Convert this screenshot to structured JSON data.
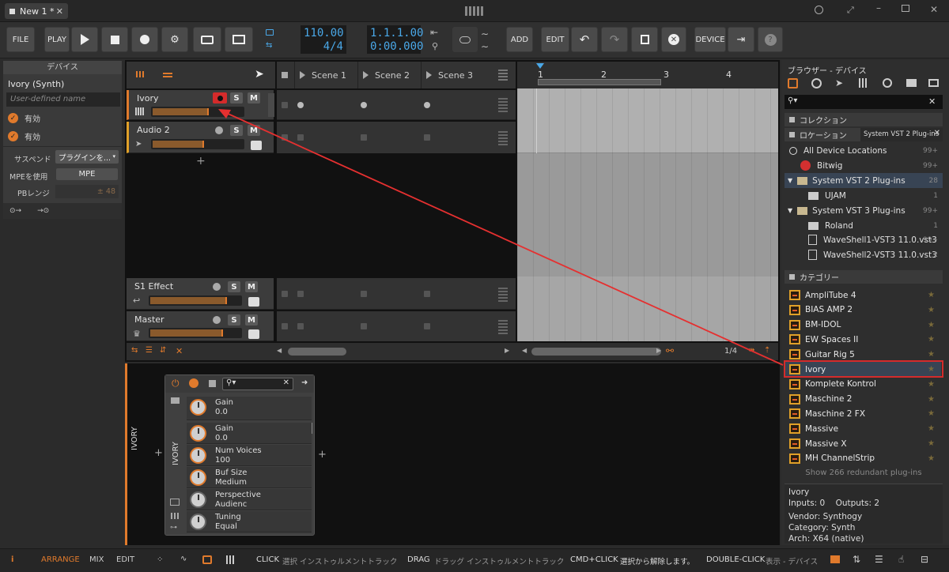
{
  "titlebar": {
    "tab_label": "New 1 *"
  },
  "transport": {
    "file": "FILE",
    "play": "PLAY",
    "tempo": "110.00",
    "time_sig": "4/4",
    "position": "1.1.1.00",
    "time": "0:00.000",
    "add": "ADD",
    "edit": "EDIT",
    "device": "DEVICE"
  },
  "inspector": {
    "header": "デバイス",
    "device_name": "Ivory (Synth)",
    "name_placeholder": "User-defined name",
    "enabled1": "有効",
    "enabled2": "有効",
    "suspend_label": "サスペンド",
    "suspend_value": "プラグインを...",
    "mpe_label": "MPEを使用",
    "mpe_button": "MPE",
    "pb_label": "PBレンジ",
    "pb_value": "± 48"
  },
  "tracks": [
    {
      "name": "Ivory",
      "level": 0.6
    },
    {
      "name": "Audio 2",
      "level": 0.55
    },
    {
      "name": "S1 Effect",
      "level": 0.82
    },
    {
      "name": "Master",
      "level": 0.78
    }
  ],
  "mute": "M",
  "solo": "S",
  "scenes": [
    "Scene 1",
    "Scene 2",
    "Scene 3"
  ],
  "ruler": [
    "1",
    "2",
    "3",
    "4"
  ],
  "zoom": "1/4",
  "browser": {
    "title": "ブラウザー - デバイス",
    "collection": "コレクション",
    "location": "ロケーション",
    "location_tab": "System VST 2 Plug-ins",
    "locations": [
      {
        "name": "All Device Locations",
        "count": "99+"
      },
      {
        "name": "Bitwig",
        "count": "99+"
      },
      {
        "name": "System VST 2 Plug-ins",
        "count": "28"
      },
      {
        "name": "UJAM",
        "count": "1"
      },
      {
        "name": "System VST 3 Plug-ins",
        "count": "99+"
      },
      {
        "name": "Roland",
        "count": "1"
      },
      {
        "name": "WaveShell1-VST3 11.0.vst3",
        "count": "99+"
      },
      {
        "name": "WaveShell2-VST3 11.0.vst3",
        "count": "2"
      }
    ],
    "category": "カテゴリー",
    "items": [
      "AmpliTube 4",
      "BIAS AMP 2",
      "BM-IDOL",
      "EW Spaces II",
      "Guitar Rig 5",
      "Ivory",
      "Komplete Kontrol",
      "Maschine 2",
      "Maschine 2 FX",
      "Massive",
      "Massive X",
      "MH ChannelStrip"
    ],
    "redundant": "Show 266 redundant plug-ins",
    "info": {
      "name": "Ivory",
      "io": "Inputs: 0    Outputs: 2",
      "vendor": "Vendor: Synthogy",
      "category": "Category: Synth",
      "arch": "Arch: X64 (native)"
    }
  },
  "device_panel": {
    "chain_label": "IVORY",
    "device_label": "IVORY",
    "params": [
      {
        "name": "Gain",
        "value": "0.0"
      },
      {
        "name": "Gain",
        "value": "0.0"
      },
      {
        "name": "Num Voices",
        "value": "100"
      },
      {
        "name": "Buf Size",
        "value": "Medium"
      },
      {
        "name": "Perspective",
        "value": "Audienc"
      },
      {
        "name": "Tuning",
        "value": "Equal"
      }
    ]
  },
  "statusbar": {
    "arrange": "ARRANGE",
    "mix": "MIX",
    "edit": "EDIT",
    "click": "CLICK",
    "click_desc": "選択 インストゥルメントトラック",
    "drag": "DRAG",
    "drag_desc": "ドラッグ インストゥルメントトラック",
    "cmdclick": "CMD+CLICK",
    "cmdclick_desc": "選択から解除します。",
    "dblclick": "DOUBLE-CLICK",
    "dblclick_desc": "表示 - デバイス"
  },
  "colors": {
    "accent": "#e07a2c",
    "highlight": "#d42b2b",
    "blue": "#4aa8e8"
  }
}
